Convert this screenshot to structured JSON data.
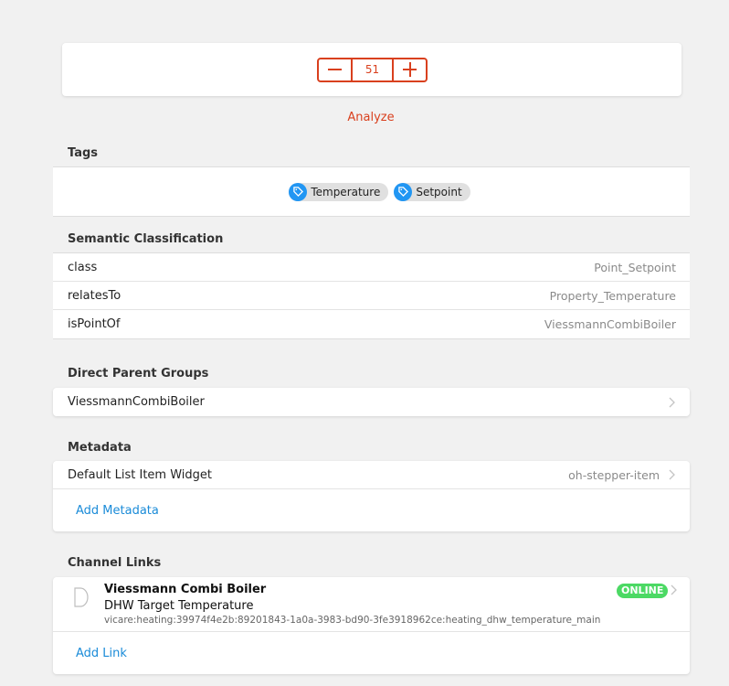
{
  "stepper": {
    "value": "51",
    "minus_icon": "minus-icon",
    "plus_icon": "plus-icon"
  },
  "analyze_label": "Analyze",
  "tags": {
    "title": "Tags",
    "items": [
      {
        "label": "Temperature",
        "icon": "tag-icon"
      },
      {
        "label": "Setpoint",
        "icon": "tag-icon"
      }
    ]
  },
  "semantic": {
    "title": "Semantic Classification",
    "rows": [
      {
        "key": "class",
        "value": "Point_Setpoint"
      },
      {
        "key": "relatesTo",
        "value": "Property_Temperature"
      },
      {
        "key": "isPointOf",
        "value": "ViessmannCombiBoiler"
      }
    ]
  },
  "parents": {
    "title": "Direct Parent Groups",
    "items": [
      {
        "label": "ViessmannCombiBoiler"
      }
    ]
  },
  "metadata": {
    "title": "Metadata",
    "rows": [
      {
        "key": "Default List Item Widget",
        "value": "oh-stepper-item"
      }
    ],
    "add_label": "Add Metadata"
  },
  "channel_links": {
    "title": "Channel Links",
    "link": {
      "thing": "Viessmann Combi Boiler",
      "channel": "DHW Target Temperature",
      "uid": "vicare:heating:39974f4e2b:89201843-1a0a-3983-bd90-3fe3918962ce:heating_dhw_temperature_main",
      "status": "ONLINE",
      "icon": "thing-icon"
    },
    "add_label": "Add Link"
  }
}
